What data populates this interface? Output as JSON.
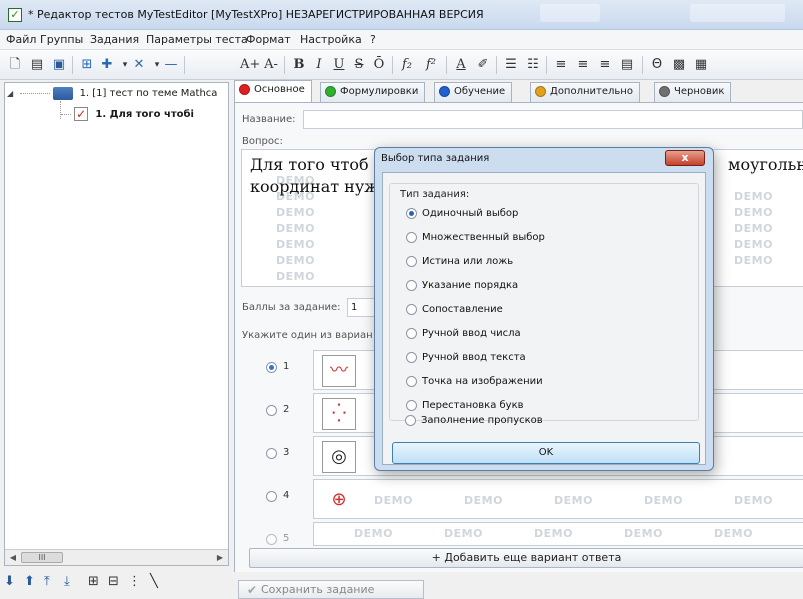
{
  "window": {
    "title": "* Редактор тестов MyTestEditor [MyTestXPro] НЕЗАРЕГИСТРИРОВАННАЯ ВЕРСИЯ",
    "app_icon": "check-icon"
  },
  "menu": [
    "Файл",
    "Группы",
    "Задания",
    "Параметры теста",
    "Формат",
    "Настройка",
    "?"
  ],
  "toolbar": {
    "icons": [
      "new-document-icon",
      "open-icon",
      "save-icon",
      "add-group-icon",
      "add-task-icon",
      "dropdown-icon",
      "delete-icon",
      "remove-icon",
      "font-increase-icon",
      "font-decrease-icon",
      "bold-icon",
      "italic-icon",
      "underline-icon",
      "strikethrough-icon",
      "overline-icon",
      "subscript-icon",
      "superscript-icon",
      "font-color-icon",
      "highlight-icon",
      "bullet-list-icon",
      "numbered-list-icon",
      "align-left-icon",
      "align-center-icon",
      "align-right-icon",
      "align-justify-icon",
      "formula-icon",
      "image-icon",
      "table-icon"
    ],
    "glyphs": {
      "font_inc": "A+",
      "font_dec": "A-",
      "bold": "B",
      "italic": "I",
      "underline": "U",
      "strike": "S",
      "overline": "Ō",
      "sub": "f₂",
      "sup": "f²",
      "color": "A"
    }
  },
  "tree": {
    "root_label": "1. [1] тест по теме Mathca",
    "child_label": "1. Для того чтобі",
    "scroll_thumb": "III"
  },
  "tabs": [
    {
      "label": "Основное",
      "color": "#e02020",
      "active": true
    },
    {
      "label": "Формулировки",
      "color": "#30b030",
      "active": false
    },
    {
      "label": "Обучение",
      "color": "#2060d0",
      "active": false
    },
    {
      "label": "Дополнительно",
      "color": "#e0a020",
      "active": false
    },
    {
      "label": "Черновик",
      "color": "#707070",
      "active": false
    }
  ],
  "form": {
    "name_label": "Название:",
    "question_label": "Вопрос:",
    "question_line1": "Для того чтоб",
    "question_line1_right": "моугольно",
    "question_line2": "координат нуж",
    "score_label": "Баллы за задание:",
    "score_value": "1",
    "instruction": "Укажите один из вариан",
    "watermark": "DEMO",
    "add_answer": "+ Добавить еще вариант ответа",
    "save_task": "Сохранить задание"
  },
  "answers": [
    {
      "num": "1",
      "checked": true,
      "image": "line-chart-icon"
    },
    {
      "num": "2",
      "checked": false,
      "image": "scatter-plot-icon"
    },
    {
      "num": "3",
      "checked": false,
      "image": "contour-plot-icon"
    },
    {
      "num": "4",
      "checked": false,
      "image": "polar-plot-icon"
    },
    {
      "num": "5",
      "checked": false,
      "image": ""
    }
  ],
  "dialog": {
    "title": "Выбор типа задания",
    "close": "x",
    "group_label": "Тип задания:",
    "options": [
      {
        "label": "Одиночный выбор",
        "checked": true
      },
      {
        "label": "Множественный выбор",
        "checked": false
      },
      {
        "label": "Истина или ложь",
        "checked": false
      },
      {
        "label": "Указание порядка",
        "checked": false
      },
      {
        "label": "Сопоставление",
        "checked": false
      },
      {
        "label": "Ручной ввод числа",
        "checked": false
      },
      {
        "label": "Ручной ввод текста",
        "checked": false
      },
      {
        "label": "Точка на изображении",
        "checked": false
      },
      {
        "label": "Перестановка букв",
        "checked": false
      },
      {
        "label": "Заполнение пропусков",
        "checked": false
      }
    ],
    "ok": "OK"
  },
  "tree_tools": [
    "move-down-icon",
    "move-up-icon",
    "move-top-icon",
    "move-bottom-icon",
    "expand-icon",
    "collapse-icon",
    "more-icon"
  ],
  "tree_tool_glyphs": [
    "⬇",
    "⬆",
    "⤒",
    "⤓",
    "⊞",
    "⊟",
    "⋮"
  ],
  "colors": {
    "accent": "#3a72c8",
    "dialog_frame": "#cdddf0",
    "close": "#c4412a"
  }
}
